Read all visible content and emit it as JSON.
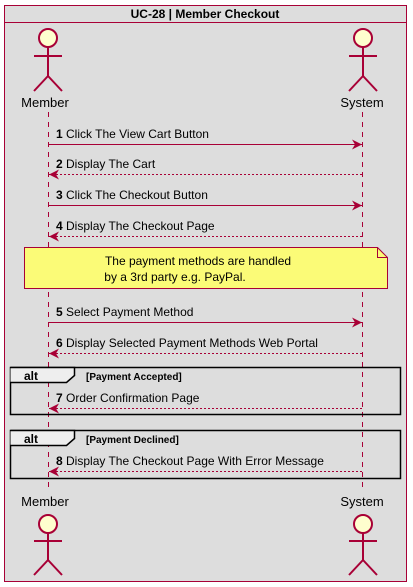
{
  "title": "UC-28 | Member Checkout",
  "colors": {
    "box_fill": "#dddddd",
    "box_border": "#a80036",
    "actor_fill": "#fefece",
    "line": "#a80036",
    "note_fill": "#fbfb77",
    "text": "#000000"
  },
  "participants": {
    "member": {
      "label": "Member",
      "icon": "actor-stick-figure-icon"
    },
    "system": {
      "label": "System",
      "icon": "actor-stick-figure-icon"
    }
  },
  "messages": [
    {
      "num": "1",
      "text": "Click The View Cart Button",
      "from": "member",
      "to": "system",
      "style": "solid"
    },
    {
      "num": "2",
      "text": "Display The Cart",
      "from": "system",
      "to": "member",
      "style": "dashed"
    },
    {
      "num": "3",
      "text": "Click The Checkout Button",
      "from": "member",
      "to": "system",
      "style": "solid"
    },
    {
      "num": "4",
      "text": "Display The Checkout Page",
      "from": "system",
      "to": "member",
      "style": "dashed"
    },
    {
      "num": "5",
      "text": "Select Payment Method",
      "from": "member",
      "to": "system",
      "style": "solid"
    },
    {
      "num": "6",
      "text": "Display Selected Payment Methods Web Portal",
      "from": "system",
      "to": "member",
      "style": "dashed"
    },
    {
      "num": "7",
      "text": "Order Confirmation Page",
      "from": "system",
      "to": "member",
      "style": "dashed"
    },
    {
      "num": "8",
      "text": "Display The Checkout Page With Error Message",
      "from": "system",
      "to": "member",
      "style": "dashed"
    }
  ],
  "note": {
    "lines": [
      "The payment methods are handled",
      "by a 3rd party e.g. PayPal."
    ]
  },
  "fragments": [
    {
      "keyword": "alt",
      "condition": "[Payment Accepted]"
    },
    {
      "keyword": "alt",
      "condition": "[Payment Declined]"
    }
  ]
}
